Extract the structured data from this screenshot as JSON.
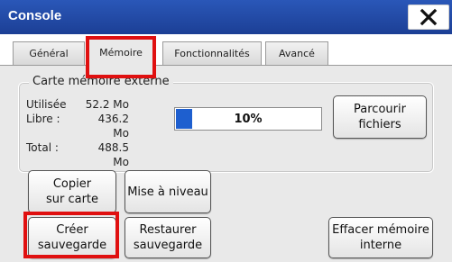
{
  "window": {
    "title": "Console",
    "close_glyph": "✕"
  },
  "tabs": [
    {
      "label": "Général",
      "active": false
    },
    {
      "label": "Mémoire",
      "active": true
    },
    {
      "label": "Fonctionnalités",
      "active": false
    },
    {
      "label": "Avancé",
      "active": false
    }
  ],
  "external_card": {
    "legend": "Carte mémoire externe",
    "used_label": "Utilisée",
    "used_value": "52.2 Mo",
    "free_label": "Libre :",
    "free_value": "436.2 Mo",
    "total_label": "Total :",
    "total_value": "488.5 Mo",
    "usage_percent_text": "10%",
    "usage_fraction": 0.107,
    "browse_button": "Parcourir\nfichiers"
  },
  "actions": {
    "copy_to_card": "Copier\nsur carte",
    "upgrade": "Mise à niveau",
    "create_backup": "Créer\nsauvegarde",
    "restore_backup": "Restaurer\nsauvegarde",
    "erase_internal": "Effacer mémoire\ninterne"
  },
  "highlights": {
    "color": "#e01010",
    "targets": [
      "tab-memoire",
      "create-backup-button"
    ]
  },
  "colors": {
    "titlebar": "#1c3f95",
    "progress_fill": "#1e5fcf",
    "panel": "#e9e9e9"
  }
}
